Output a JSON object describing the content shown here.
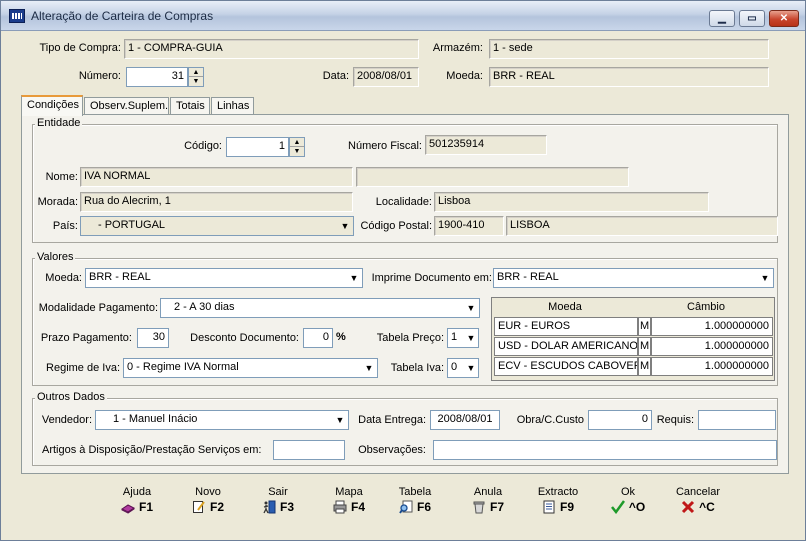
{
  "window": {
    "title": "Alteração de Carteira de Compras"
  },
  "header": {
    "tipo_compra_label": "Tipo de Compra:",
    "tipo_compra_value": "1 - COMPRA-GUIA",
    "armazem_label": "Armazém:",
    "armazem_value": "1 - sede",
    "numero_label": "Número:",
    "numero_value": "31",
    "data_label": "Data:",
    "data_value": "2008/08/01",
    "moeda_label": "Moeda:",
    "moeda_value": "BRR - REAL"
  },
  "tabs": [
    {
      "label": "Condições"
    },
    {
      "label": "Observ.Suplem."
    },
    {
      "label": "Totais"
    },
    {
      "label": "Linhas"
    }
  ],
  "entidade": {
    "title": "Entidade",
    "codigo_label": "Código:",
    "codigo_value": "1",
    "nif_label": "Número Fiscal:",
    "nif_value": "501235914",
    "nome_label": "Nome:",
    "nome_value": "IVA NORMAL",
    "nome2_value": "",
    "morada_label": "Morada:",
    "morada_value": "Rua do Alecrim, 1",
    "localidade_label": "Localidade:",
    "localidade_value": "Lisboa",
    "pais_label": "País:",
    "pais_value": "- PORTUGAL",
    "cp_label": "Código Postal:",
    "cp_value": "1900-410",
    "cp_local_value": "LISBOA"
  },
  "valores": {
    "title": "Valores",
    "moeda_label": "Moeda:",
    "moeda_value": "BRR - REAL",
    "imprime_label": "Imprime Documento em:",
    "imprime_value": "BRR - REAL",
    "modalidade_label": "Modalidade Pagamento:",
    "modalidade_value": "2 - A 30 dias",
    "prazo_label": "Prazo Pagamento:",
    "prazo_value": "30",
    "desconto_label": "Desconto Documento:",
    "desconto_value": "0",
    "percent": "%",
    "tabela_preco_label": "Tabela Preço:",
    "tabela_preco_value": "1",
    "regime_label": "Regime de Iva:",
    "regime_value": "0 - Regime IVA Normal",
    "tabela_iva_label": "Tabela Iva:",
    "tabela_iva_value": "0",
    "cambio_table": {
      "col_moeda": "Moeda",
      "col_cambio": "Câmbio",
      "rows": [
        {
          "moeda": "EUR - EUROS",
          "flag": "M",
          "cambio": "1.000000000"
        },
        {
          "moeda": "USD - DOLAR AMERICANO",
          "flag": "M",
          "cambio": "1.000000000"
        },
        {
          "moeda": "ECV - ESCUDOS CABOVERD",
          "flag": "M",
          "cambio": "1.000000000"
        }
      ]
    }
  },
  "outros": {
    "title": "Outros Dados",
    "vendedor_label": "Vendedor:",
    "vendedor_value": "1 - Manuel Inácio",
    "data_entrega_label": "Data  Entrega:",
    "data_entrega_value": "2008/08/01",
    "obra_label": "Obra/C.Custo",
    "obra_value": "0",
    "requis_label": "Requis:",
    "requis_value": "",
    "artigos_label": "Artigos à Disposição/Prestação Serviços em:",
    "artigos_value": "",
    "observacoes_label": "Observações:",
    "observacoes_value": ""
  },
  "footer": [
    {
      "caption": "Ajuda",
      "key": "F1",
      "icon": "book-icon",
      "color": "#b03ca0"
    },
    {
      "caption": "Novo",
      "key": "F2",
      "icon": "new-document-icon",
      "color": "#d9b64a"
    },
    {
      "caption": "Sair",
      "key": "F3",
      "icon": "exit-door-icon",
      "color": "#2a5db0"
    },
    {
      "caption": "Mapa",
      "key": "F4",
      "icon": "printer-icon",
      "color": "#777777"
    },
    {
      "caption": "Tabela",
      "key": "F6",
      "icon": "search-table-icon",
      "color": "#3a7bc8"
    },
    {
      "caption": "Anula",
      "key": "F7",
      "icon": "trash-icon",
      "color": "#8a8a8a"
    },
    {
      "caption": "Extracto",
      "key": "F9",
      "icon": "document-list-icon",
      "color": "#3a5a9a"
    },
    {
      "caption": "Ok",
      "key": "^O",
      "icon": "check-icon",
      "color": "#1e9a2a"
    },
    {
      "caption": "Cancelar",
      "key": "^C",
      "icon": "cross-icon",
      "color": "#c01818"
    }
  ]
}
